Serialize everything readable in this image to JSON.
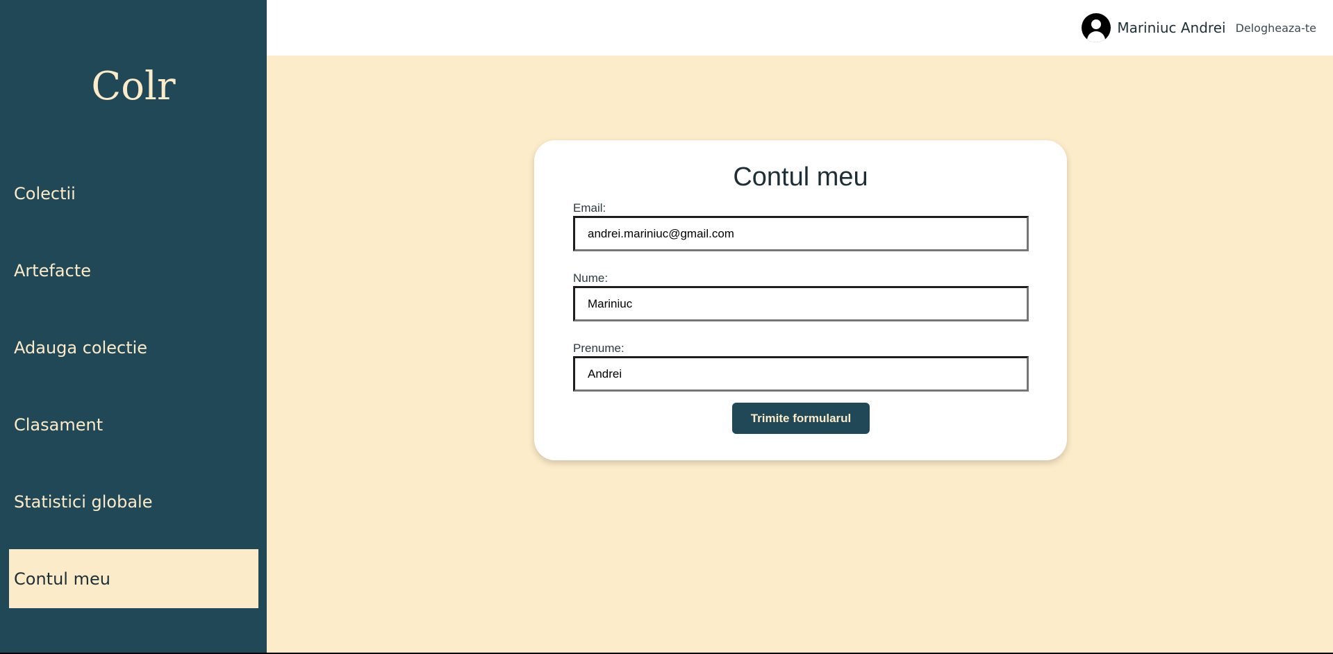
{
  "sidebar": {
    "logo": "Colr",
    "items": [
      {
        "label": "Colectii"
      },
      {
        "label": "Artefacte"
      },
      {
        "label": "Adauga colectie"
      },
      {
        "label": "Clasament"
      },
      {
        "label": "Statistici globale"
      },
      {
        "label": "Contul meu",
        "active": true
      }
    ]
  },
  "header": {
    "user_name": "Mariniuc Andrei",
    "logout_label": "Delogheaza-te",
    "avatar_icon": "user-circle-icon"
  },
  "form": {
    "title": "Contul meu",
    "email_label": "Email:",
    "email_value": "andrei.mariniuc@gmail.com",
    "nume_label": "Nume:",
    "nume_value": "Mariniuc",
    "prenume_label": "Prenume:",
    "prenume_value": "Andrei",
    "submit_label": "Trimite formularul"
  },
  "colors": {
    "sidebar_bg": "#214856",
    "accent_cream": "#fcebc8",
    "main_bg": "#fdecc9",
    "button_bg": "#214856"
  }
}
